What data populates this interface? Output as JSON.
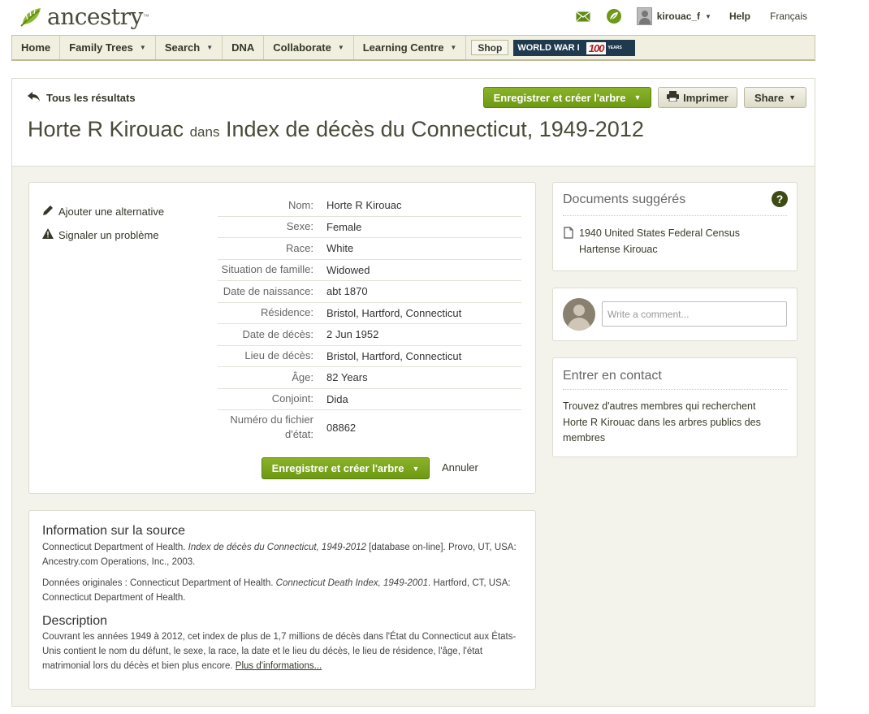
{
  "header": {
    "logo_text": "ancestry",
    "username": "kirouac_f",
    "help": "Help",
    "language": "Français"
  },
  "nav": {
    "items": [
      {
        "label": "Home",
        "dropdown": false
      },
      {
        "label": "Family Trees",
        "dropdown": true
      },
      {
        "label": "Search",
        "dropdown": true
      },
      {
        "label": "DNA",
        "dropdown": false
      },
      {
        "label": "Collaborate",
        "dropdown": true
      },
      {
        "label": "Learning Centre",
        "dropdown": true
      }
    ],
    "shop": "Shop",
    "banner": {
      "text": "WORLD WAR I",
      "number": "100",
      "suffix": "YEARS"
    }
  },
  "toolbar": {
    "back_label": "Tous les résultats",
    "save_label": "Enregistrer et créer l'arbre",
    "print_label": "Imprimer",
    "share_label": "Share"
  },
  "title": {
    "name": "Horte R Kirouac",
    "connector": "dans",
    "collection": "Index de décès du Connecticut, 1949-2012"
  },
  "record": {
    "actions": {
      "add_alternative": "Ajouter une alternative",
      "report_problem": "Signaler un problème"
    },
    "facts": [
      {
        "label": "Nom:",
        "value": "Horte R Kirouac"
      },
      {
        "label": "Sexe:",
        "value": "Female"
      },
      {
        "label": "Race:",
        "value": "White"
      },
      {
        "label": "Situation de famille:",
        "value": "Widowed"
      },
      {
        "label": "Date de naissance:",
        "value": "abt 1870"
      },
      {
        "label": "Résidence:",
        "value": "Bristol, Hartford, Connecticut"
      },
      {
        "label": "Date de décès:",
        "value": "2 Jun 1952"
      },
      {
        "label": "Lieu de décès:",
        "value": "Bristol, Hartford, Connecticut"
      },
      {
        "label": "Âge:",
        "value": "82 Years"
      },
      {
        "label": "Conjoint:",
        "value": "Dida"
      },
      {
        "label": "Numéro du fichier d'état:",
        "value": "08862"
      }
    ],
    "save_label": "Enregistrer et créer l'arbre",
    "cancel_label": "Annuler"
  },
  "source": {
    "heading": "Information sur la source",
    "citation_pre": "Connecticut Department of Health. ",
    "citation_title": "Index de décès du Connecticut, 1949-2012",
    "citation_post": " [database on-line]. Provo, UT, USA: Ancestry.com Operations, Inc., 2003.",
    "original_pre": "Données originales : Connecticut Department of Health. ",
    "original_title": "Connecticut Death Index, 1949-2001",
    "original_post": ". Hartford, CT, USA: Connecticut Department of Health.",
    "description_heading": "Description",
    "description_text": "Couvrant les années 1949 à 2012, cet index de plus de 1,7 millions de décès dans l'État du Connecticut aux États-Unis contient le nom du défunt, le sexe, la race, la date et le lieu du décès, le lieu de résidence, l'âge, l'état matrimonial lors du décès et bien plus encore. ",
    "more_link": "Plus d'informations..."
  },
  "suggested": {
    "title": "Documents suggérés",
    "help_icon": "?",
    "doc_title": "1940 United States Federal Census",
    "doc_person": "Hartense Kirouac"
  },
  "comment": {
    "placeholder": "Write a comment..."
  },
  "contact": {
    "title": "Entrer en contact",
    "text": "Trouvez d'autres membres qui recherchent Horte R Kirouac dans les arbres publics des membres"
  },
  "colors": {
    "accent_green": "#6c9a12",
    "nav_bg": "#f0efe0",
    "page_bg": "#f3f3ec"
  }
}
